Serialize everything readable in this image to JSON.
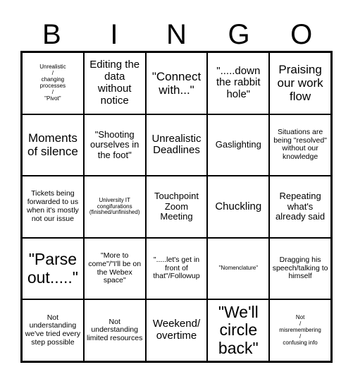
{
  "header": [
    "B",
    "I",
    "N",
    "G",
    "O"
  ],
  "cells": [
    {
      "text": "Unrealistic\n/\nchanging\nprocesses\n/\n\"Pivot\"",
      "size": "xs"
    },
    {
      "text": "Editing the data without notice",
      "size": "lg"
    },
    {
      "text": "\"Connect with...\"",
      "size": "xl"
    },
    {
      "text": "\".....down the rabbit hole\"",
      "size": "lg"
    },
    {
      "text": "Praising our work flow",
      "size": "xl"
    },
    {
      "text": "Moments of silence",
      "size": "xl"
    },
    {
      "text": "\"Shooting ourselves in the foot\"",
      "size": "md"
    },
    {
      "text": "Unrealistic Deadlines",
      "size": "lg"
    },
    {
      "text": "Gaslighting",
      "size": "md"
    },
    {
      "text": "Situations are being \"resolved\" without our knowledge",
      "size": "sm"
    },
    {
      "text": "Tickets being forwarded to us when it's mostly not our issue",
      "size": "sm"
    },
    {
      "text": "University IT congifurations (finished/unfinished)",
      "size": "xs"
    },
    {
      "text": "Touchpoint Zoom Meeting",
      "size": "md"
    },
    {
      "text": "Chuckling",
      "size": "lg"
    },
    {
      "text": "Repeating what's already said",
      "size": "md"
    },
    {
      "text": "\"Parse out.....\"",
      "size": "huge"
    },
    {
      "text": "\"More to come\"/\"I'll be on the Webex space\"",
      "size": "sm"
    },
    {
      "text": "\".....let's get in front of that\"/Followup",
      "size": "sm"
    },
    {
      "text": "\"Nomenclature\"",
      "size": "xs"
    },
    {
      "text": "Dragging his speech/talking to himself",
      "size": "sm"
    },
    {
      "text": "Not understanding we've tried every step possible",
      "size": "sm"
    },
    {
      "text": "Not understanding limited resources",
      "size": "sm"
    },
    {
      "text": "Weekend/ overtime",
      "size": "lg"
    },
    {
      "text": "\"We'll circle back\"",
      "size": "huge"
    },
    {
      "text": "Not\n/\nmisremembering\n/\nconfusing info",
      "size": "xs"
    }
  ]
}
